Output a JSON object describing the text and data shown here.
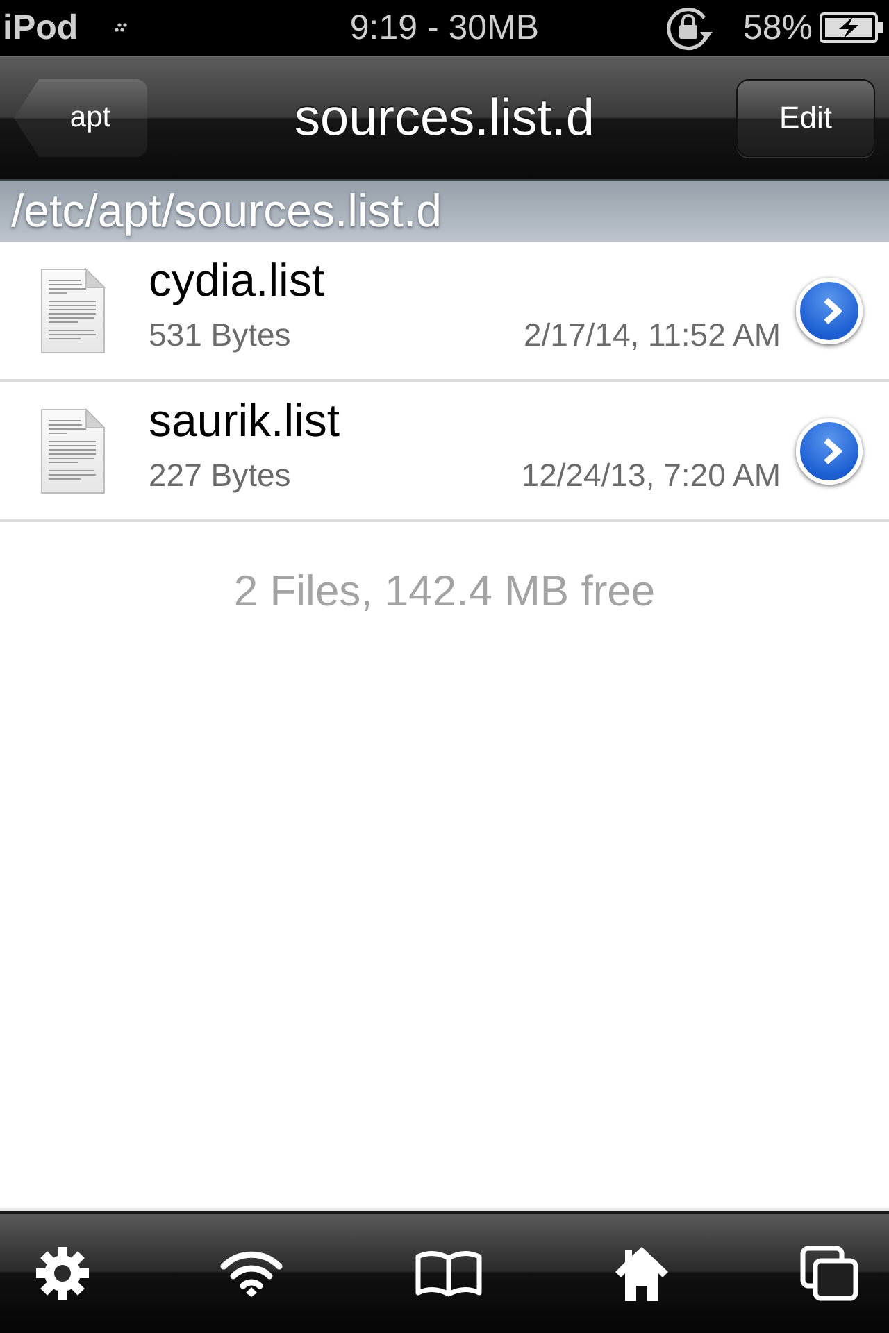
{
  "status_bar": {
    "device": "iPod",
    "time": "9:19 - 30MB",
    "battery": "58%"
  },
  "nav_bar": {
    "back_button": "apt",
    "title": "sources.list.d",
    "edit_button": "Edit"
  },
  "path_header": "/etc/apt/sources.list.d",
  "files": [
    {
      "name": "cydia.list",
      "size": "531 Bytes",
      "modified": "2/17/14, 11:52 AM"
    },
    {
      "name": "saurik.list",
      "size": "227 Bytes",
      "modified": "12/24/13, 7:20 AM"
    }
  ],
  "summary": "2 Files, 142.4 MB free"
}
